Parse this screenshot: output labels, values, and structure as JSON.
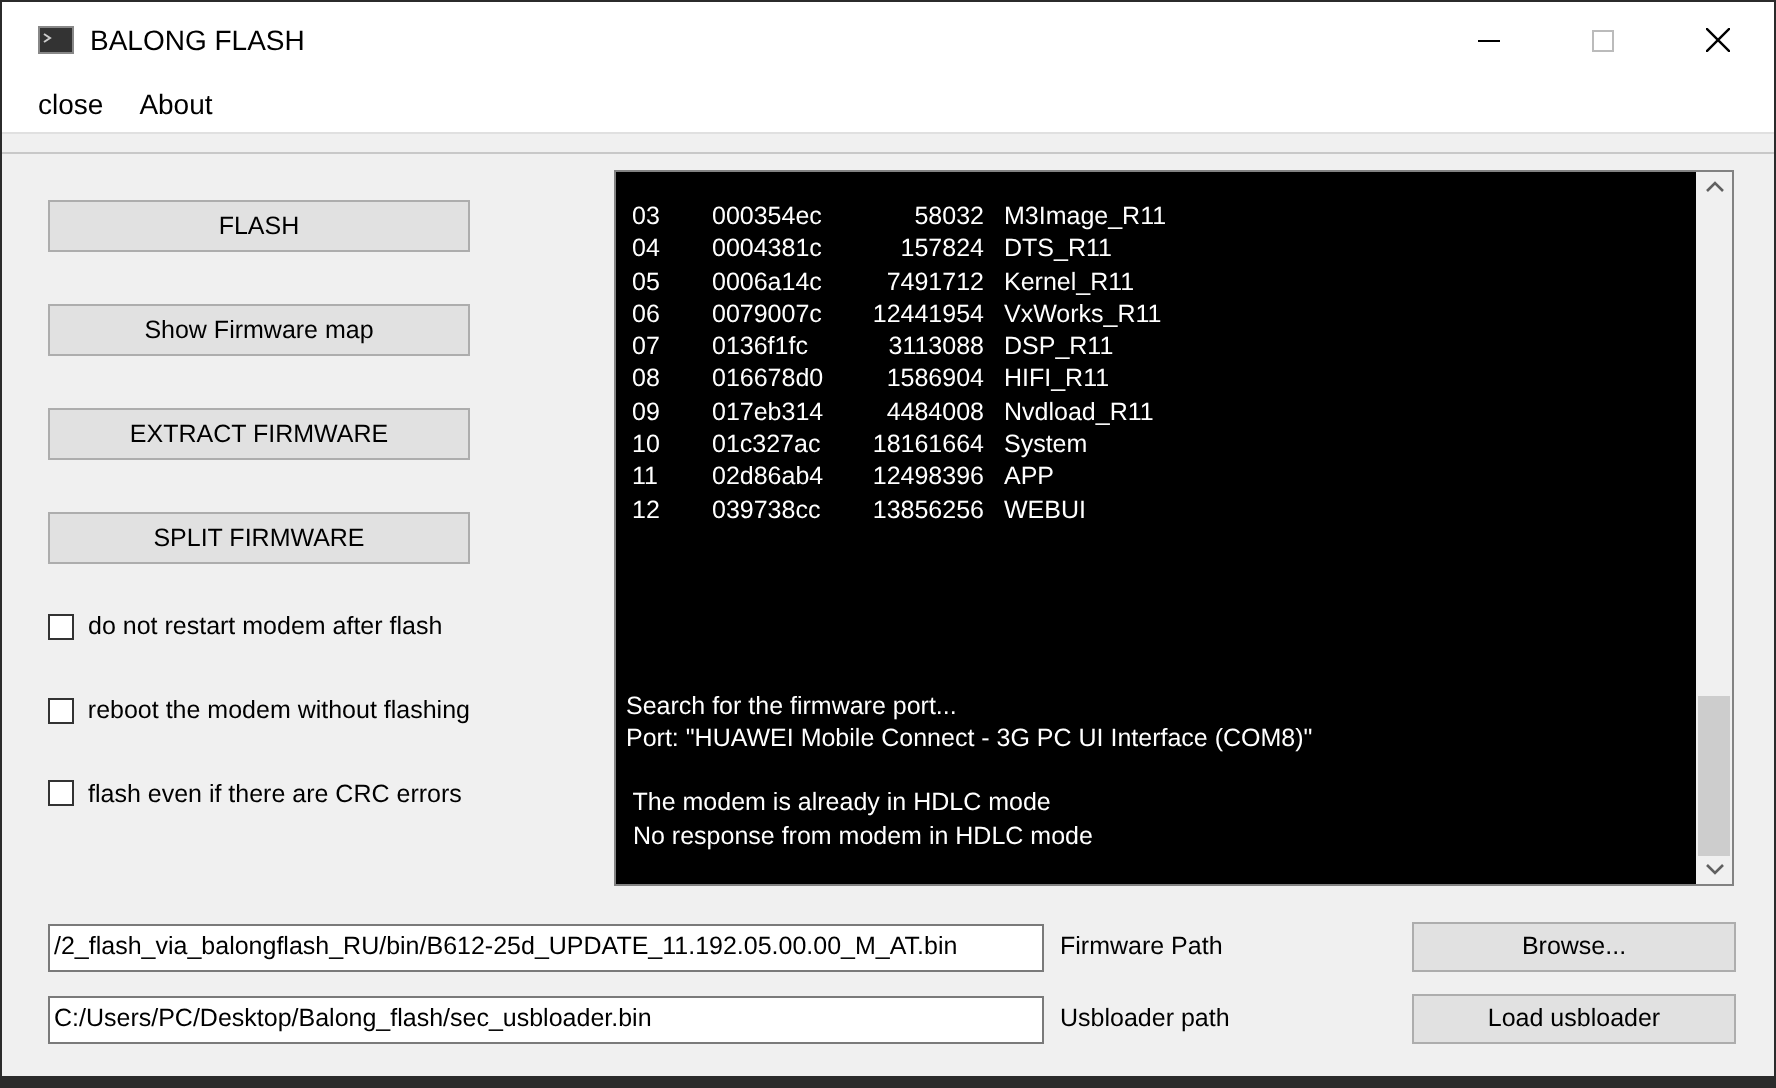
{
  "window": {
    "title": "BALONG FLASH"
  },
  "menu": [
    "close",
    "About"
  ],
  "buttons": [
    "FLASH",
    "Show Firmware map",
    "EXTRACT FIRMWARE",
    "SPLIT FIRMWARE"
  ],
  "options": [
    {
      "label": "do not restart modem after flash",
      "checked": false
    },
    {
      "label": "reboot the modem without flashing",
      "checked": false
    },
    {
      "label": "flash even if there are CRC errors",
      "checked": false
    }
  ],
  "log": {
    "partitions": [
      [
        "03",
        "000354ec",
        "58032",
        "M3Image_R11"
      ],
      [
        "04",
        "0004381c",
        "157824",
        "DTS_R11"
      ],
      [
        "05",
        "0006a14c",
        "7491712",
        "Kernel_R11"
      ],
      [
        "06",
        "0079007c",
        "12441954",
        "VxWorks_R11"
      ],
      [
        "07",
        "0136f1fc",
        "3113088",
        "DSP_R11"
      ],
      [
        "08",
        "016678d0",
        "1586904",
        "HIFI_R11"
      ],
      [
        "09",
        "017eb314",
        "4484008",
        "Nvdload_R11"
      ],
      [
        "10",
        "01c327ac",
        "18161664",
        "System"
      ],
      [
        "11",
        "02d86ab4",
        "12498396",
        "APP"
      ],
      [
        "12",
        "039738cc",
        "13856256",
        "WEBUI"
      ]
    ],
    "messages": [
      [
        "Search for the firmware port...",
        "Port: \"HUAWEI Mobile Connect - 3G PC UI Interface (COM8)\""
      ],
      [
        " The modem is already in HDLC mode",
        " No response from modem in HDLC mode"
      ]
    ]
  },
  "paths": [
    {
      "value": "/2_flash_via_balongflash_RU/bin/B612-25d_UPDATE_11.192.05.00.00_M_AT.bin",
      "label": "Firmware Path",
      "button": "Browse..."
    },
    {
      "value": "C:/Users/PC/Desktop/Balong_flash/sec_usbloader.bin",
      "label": "Usbloader path",
      "button": "Load usbloader"
    }
  ]
}
